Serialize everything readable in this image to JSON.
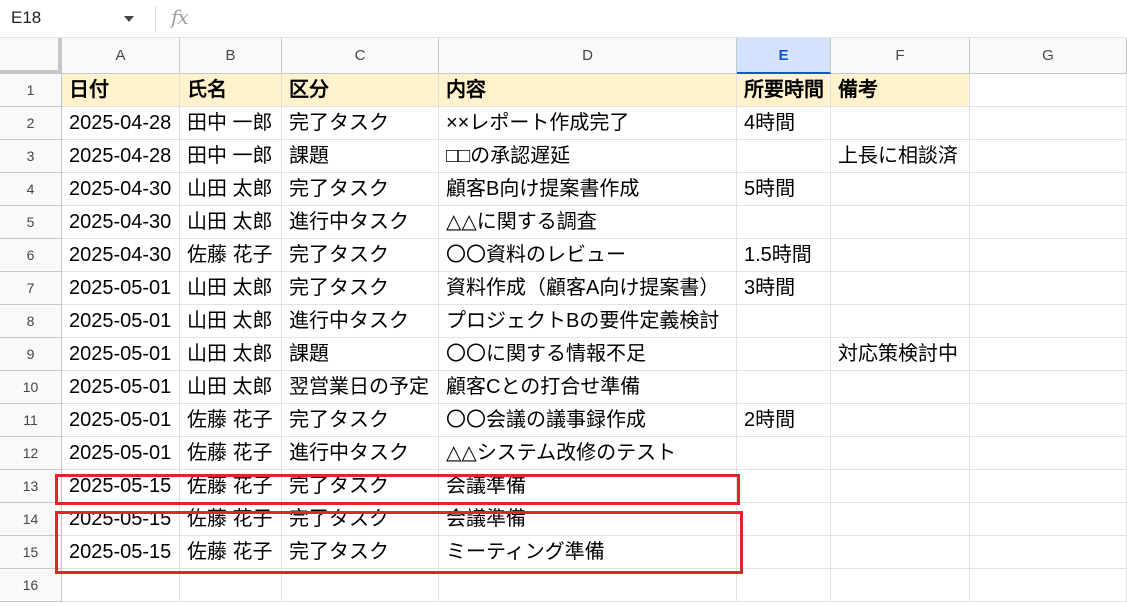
{
  "name_box": {
    "value": "E18"
  },
  "formula_bar": {
    "fx_label": "fx",
    "value": ""
  },
  "columns": [
    "A",
    "B",
    "C",
    "D",
    "E",
    "F",
    "G"
  ],
  "active_column": "E",
  "rows": [
    {
      "num": "1",
      "cells": [
        "日付",
        "氏名",
        "区分",
        "内容",
        "所要時間",
        "備考",
        ""
      ]
    },
    {
      "num": "2",
      "cells": [
        "2025-04-28",
        "田中 一郎",
        "完了タスク",
        "××レポート作成完了",
        "4時間",
        "",
        ""
      ]
    },
    {
      "num": "3",
      "cells": [
        "2025-04-28",
        "田中 一郎",
        "課題",
        "□□の承認遅延",
        "",
        "上長に相談済",
        ""
      ]
    },
    {
      "num": "4",
      "cells": [
        "2025-04-30",
        "山田 太郎",
        "完了タスク",
        "顧客B向け提案書作成",
        "5時間",
        "",
        ""
      ]
    },
    {
      "num": "5",
      "cells": [
        "2025-04-30",
        "山田 太郎",
        "進行中タスク",
        "△△に関する調査",
        "",
        "",
        ""
      ]
    },
    {
      "num": "6",
      "cells": [
        "2025-04-30",
        "佐藤 花子",
        "完了タスク",
        "〇〇資料のレビュー",
        "1.5時間",
        "",
        ""
      ]
    },
    {
      "num": "7",
      "cells": [
        "2025-05-01",
        "山田 太郎",
        "完了タスク",
        "資料作成（顧客A向け提案書）",
        "3時間",
        "",
        ""
      ]
    },
    {
      "num": "8",
      "cells": [
        "2025-05-01",
        "山田 太郎",
        "進行中タスク",
        "プロジェクトBの要件定義検討",
        "",
        "",
        ""
      ]
    },
    {
      "num": "9",
      "cells": [
        "2025-05-01",
        "山田 太郎",
        "課題",
        "〇〇に関する情報不足",
        "",
        "対応策検討中",
        ""
      ]
    },
    {
      "num": "10",
      "cells": [
        "2025-05-01",
        "山田 太郎",
        "翌営業日の予定",
        "顧客Cとの打合せ準備",
        "",
        "",
        ""
      ]
    },
    {
      "num": "11",
      "cells": [
        "2025-05-01",
        "佐藤 花子",
        "完了タスク",
        "〇〇会議の議事録作成",
        "2時間",
        "",
        ""
      ]
    },
    {
      "num": "12",
      "cells": [
        "2025-05-01",
        "佐藤 花子",
        "進行中タスク",
        "△△システム改修のテスト",
        "",
        "",
        ""
      ]
    },
    {
      "num": "13",
      "cells": [
        "2025-05-15",
        "佐藤 花子",
        "完了タスク",
        "会議準備",
        "",
        "",
        ""
      ]
    },
    {
      "num": "14",
      "cells": [
        "2025-05-15",
        "佐藤 花子",
        "完了タスク",
        "会議準備",
        "",
        "",
        ""
      ]
    },
    {
      "num": "15",
      "cells": [
        "2025-05-15",
        "佐藤 花子",
        "完了タスク",
        "ミーティング準備",
        "",
        "",
        ""
      ]
    },
    {
      "num": "16",
      "cells": [
        "",
        "",
        "",
        "",
        "",
        "",
        ""
      ]
    }
  ],
  "colors": {
    "header_fill": "#fff2cc",
    "active_column_fill": "#d3e3fd",
    "highlight_border": "#e0252b"
  }
}
